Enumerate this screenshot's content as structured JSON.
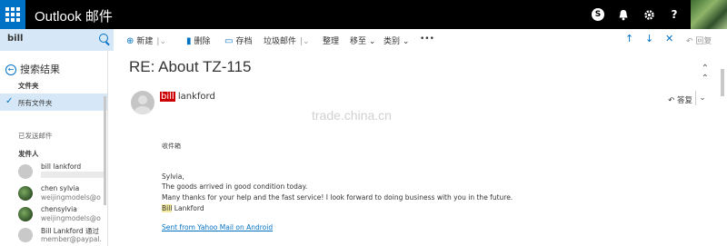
{
  "topbar": {
    "app_title": "Outlook 邮件",
    "icons": [
      "skype-icon",
      "bell-icon",
      "gear-icon",
      "help-icon"
    ],
    "skype_glyph": "S",
    "help_glyph": "?"
  },
  "search": {
    "value": "bill"
  },
  "toolbar": {
    "new_label": "新建",
    "delete_label": "删除",
    "archive_label": "存档",
    "junk_label": "垃圾邮件",
    "sweep_label": "整理",
    "move_label": "移至",
    "category_label": "类别",
    "more_label": "•••",
    "reply_all_label": "回复"
  },
  "sidebar": {
    "back_label": "搜索结果",
    "folders_heading": "文件夹",
    "all_folders_label": "所有文件夹",
    "sent_heading": "已发送邮件",
    "senders_heading": "发件人",
    "people": [
      {
        "name": "bill lankford",
        "email": ""
      },
      {
        "name": "chen sylvia",
        "email": "weijingmodels@o"
      },
      {
        "name": "chensylvia",
        "email": "weijingmodels@o"
      },
      {
        "name": "Bill Lankford 通过",
        "email": "member@paypal."
      }
    ]
  },
  "message": {
    "subject": "RE: About TZ-115",
    "sender_highlight": "bill",
    "sender_rest": " lankford",
    "reply_label": "答复",
    "to_label": "收件箱",
    "greeting": "Sylvia,",
    "line1": "The goods arrived in good condition today.",
    "line2": "Many thanks for your help and the fast service! I look forward to doing business with you in the future.",
    "sign_highlight": "Bill",
    "sign_rest": " Lankford",
    "link": "Sent from Yahoo Mail on Android"
  },
  "watermark": "trade.china.cn",
  "colors": {
    "accent": "#0072c6",
    "topbar": "#000000",
    "selected": "#d6e8f7",
    "highlight_red": "#cc0000",
    "highlight_yellow": "#f3e9a0"
  }
}
